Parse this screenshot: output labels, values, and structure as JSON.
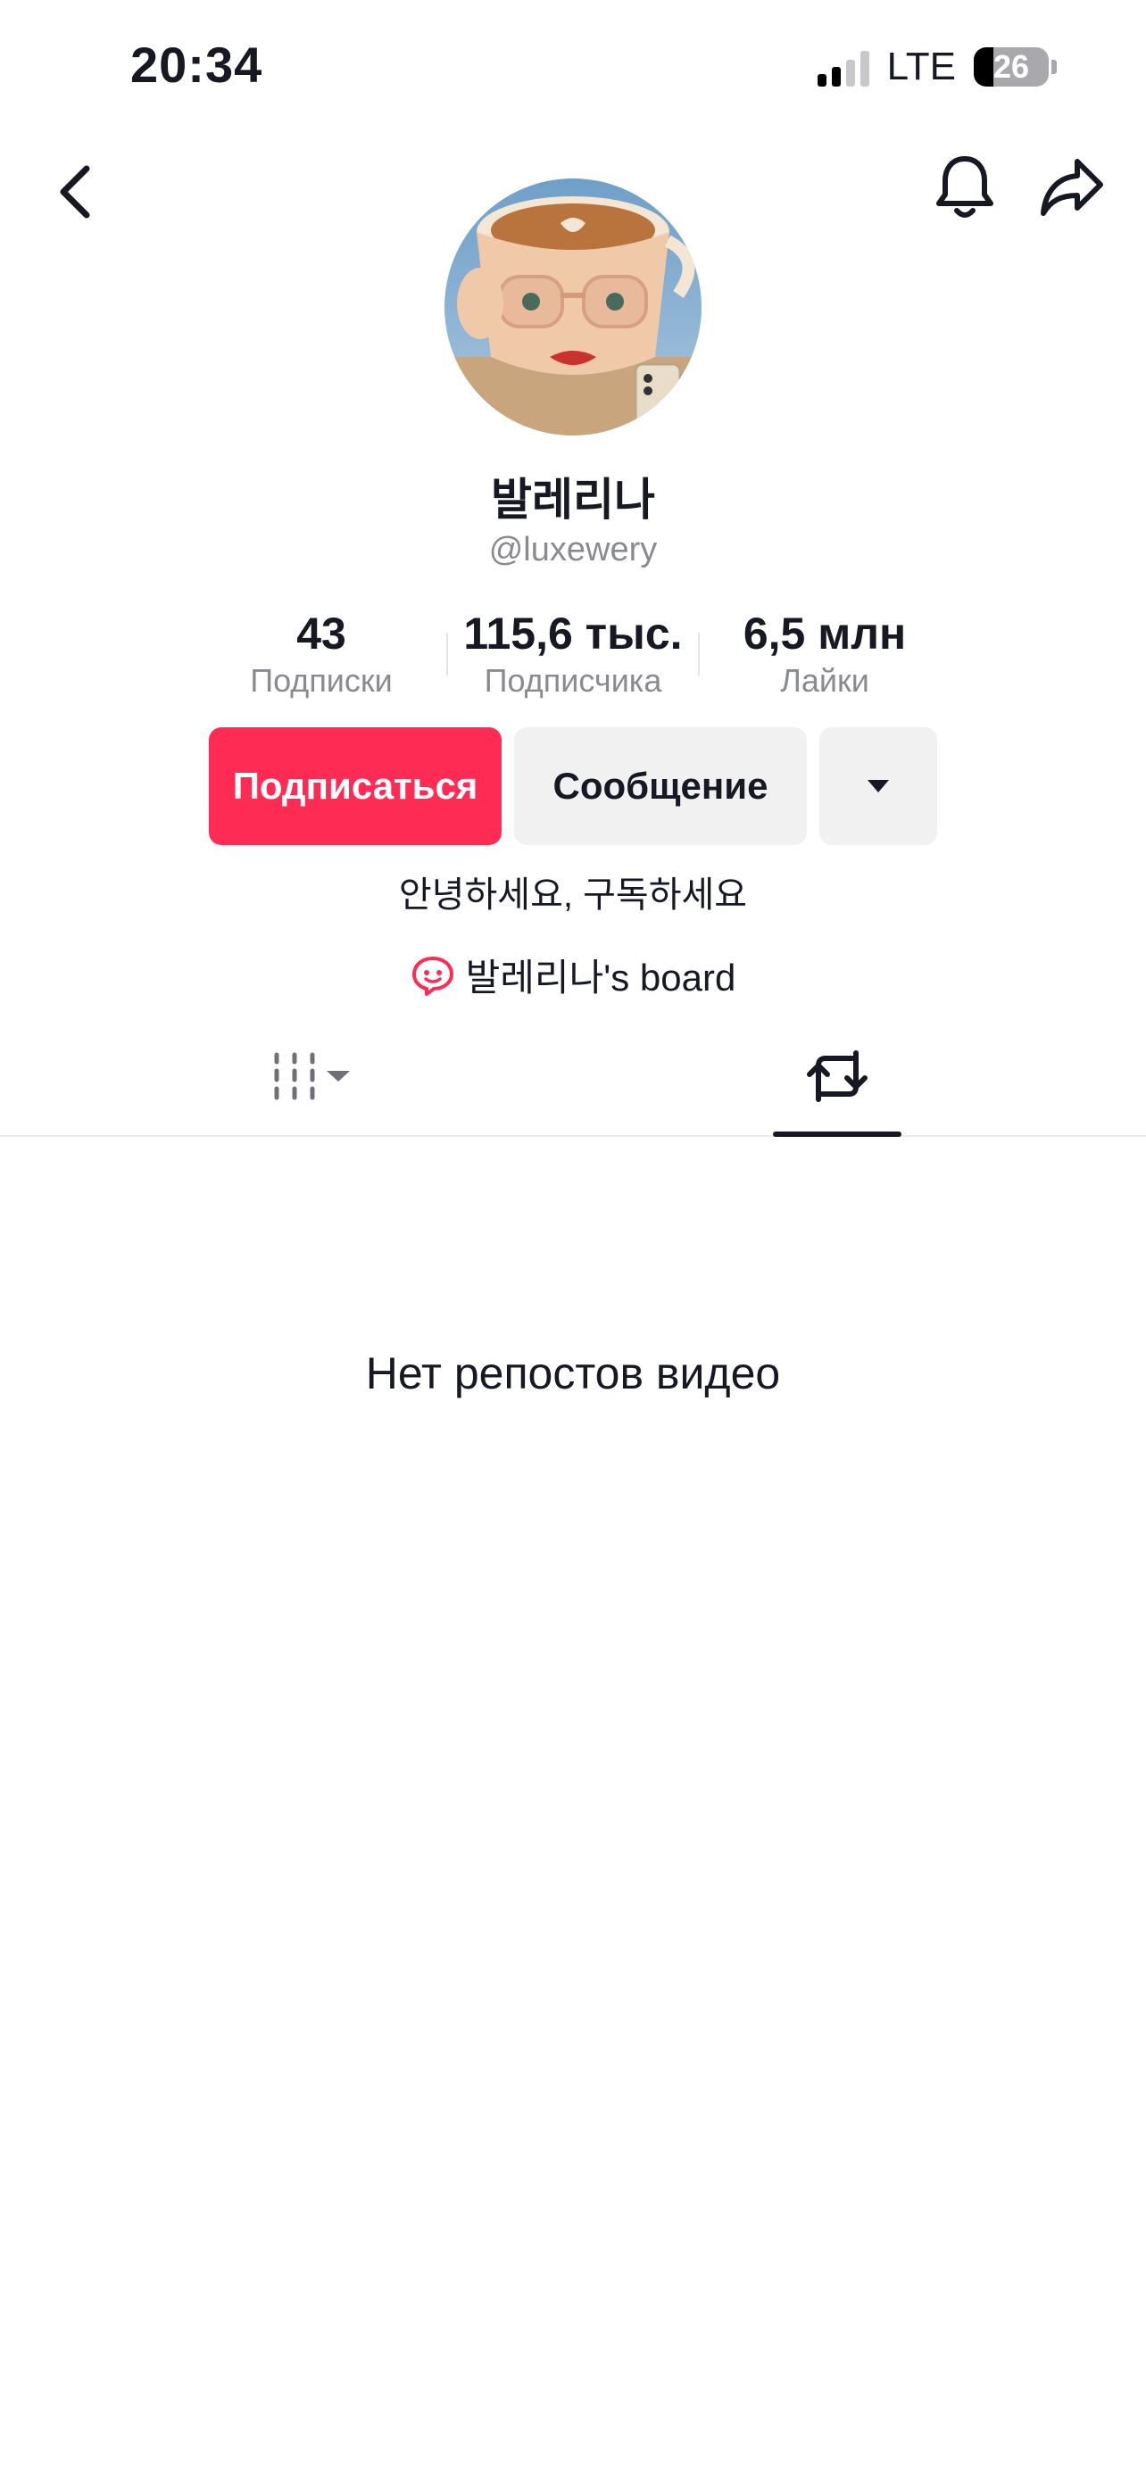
{
  "status_bar": {
    "time": "20:34",
    "network": "LTE",
    "battery_percent": 26
  },
  "nav": {
    "back_icon": "chevron-left-icon",
    "bell_icon": "bell-icon",
    "share_icon": "share-arrow-icon"
  },
  "profile": {
    "display_name": "발레리나",
    "handle": "@luxewery",
    "bio": "안녕하세요, 구독하세요",
    "board_label": "발레리나's board",
    "board_icon": "chat-bubble-smile-icon"
  },
  "stats": [
    {
      "value": "43",
      "label": "Подписки"
    },
    {
      "value": "115,6 тыс.",
      "label": "Подписчика"
    },
    {
      "value": "6,5 млн",
      "label": "Лайки"
    }
  ],
  "actions": {
    "follow_label": "Подписаться",
    "message_label": "Сообщение",
    "more_icon": "caret-down-icon"
  },
  "tabs": [
    {
      "name": "videos-grid",
      "icon": "grid-lines-icon",
      "selected": false
    },
    {
      "name": "reposts",
      "icon": "repost-icon",
      "selected": true
    }
  ],
  "content": {
    "empty_message": "Нет репостов видео"
  },
  "colors": {
    "accent": "#fe2c55",
    "secondary_bg": "#f1f1f2",
    "muted_text": "#8a8b91",
    "text": "#161823"
  }
}
